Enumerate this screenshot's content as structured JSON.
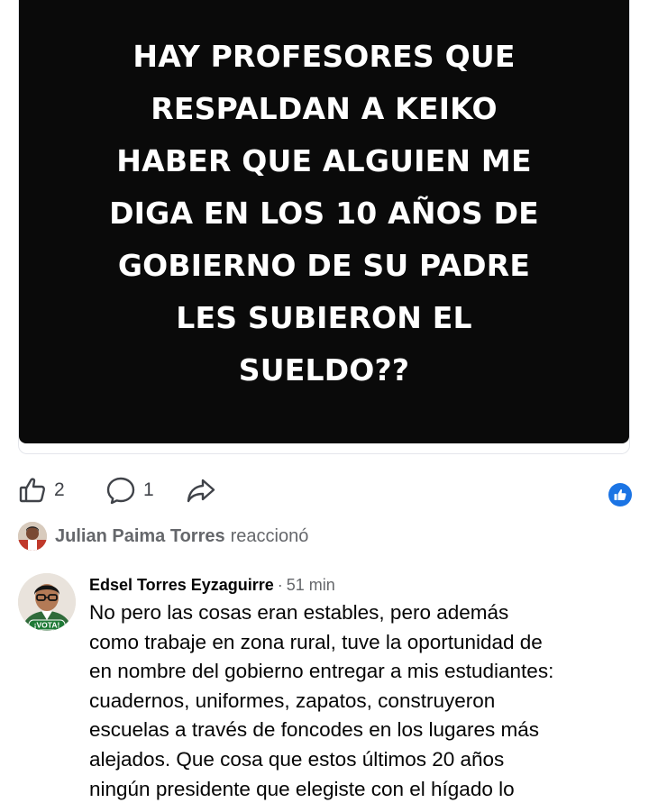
{
  "post": {
    "image_text": "HAY PROFESORES QUE\nRESPALDAN A KEIKO\nHABER QUE ALGUIEN ME\nDIGA EN LOS 10 AÑOS DE\nGOBIERNO DE SU PADRE\nLES SUBIERON EL\nSUELDO??",
    "image_background": "#0a0a0a",
    "image_text_color": "#ffffff"
  },
  "actions": {
    "like_icon": "thumbs-up-outline-icon",
    "like_count": "2",
    "comment_icon": "comment-bubble-icon",
    "comment_count": "1",
    "share_icon": "share-arrow-icon",
    "reaction_icon": "like-reaction-badge-icon",
    "reaction_color": "#1b74e4"
  },
  "reaction_notice": {
    "name": "Julian Paima Torres",
    "verb": "reaccionó"
  },
  "comment": {
    "author": "Edsel Torres Eyzaguirre",
    "separator": "·",
    "time": "51 min",
    "avatar_badge": "¡VOTA!",
    "text": "No pero las cosas eran estables, pero además\ncomo trabaje en zona rural, tuve la oportunidad de\nen nombre del gobierno entregar a mis estudiantes:\ncuadernos, uniformes, zapatos, construyeron\nescuelas a través de foncodes en los lugares más\nalejados. Que cosa que estos últimos 20 años\nningún presidente que elegiste con el hígado lo"
  }
}
